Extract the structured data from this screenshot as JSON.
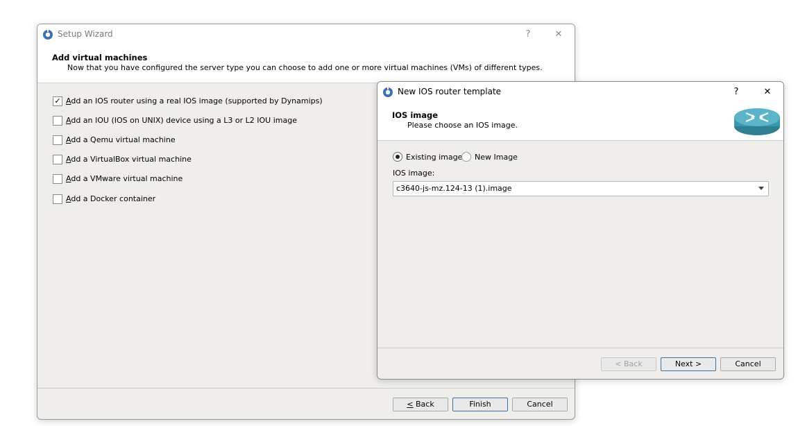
{
  "setup_wizard": {
    "title": "Setup Wizard",
    "help": "?",
    "close": "✕",
    "header_title": "Add virtual machines",
    "header_subtitle": "Now that you have configured the server type you can choose to add one or more virtual machines (VMs) of different types.",
    "options": [
      {
        "label": "Add an IOS router using a real IOS image (supported by Dynamips)",
        "checked": true
      },
      {
        "label": "Add an IOU (IOS on UNIX) device using a L3 or L2 IOU image",
        "checked": false
      },
      {
        "label": "Add a Qemu virtual machine",
        "checked": false
      },
      {
        "label": "Add a VirtualBox virtual machine",
        "checked": false
      },
      {
        "label": "Add a VMware virtual machine",
        "checked": false
      },
      {
        "label": "Add a Docker container",
        "checked": false
      }
    ],
    "back_label": "< Back",
    "finish_label": "Finish",
    "cancel_label": "Cancel"
  },
  "ios_dialog": {
    "title": "New IOS router template",
    "help": "?",
    "close": "✕",
    "header_title": "IOS image",
    "header_subtitle": "Please choose an IOS image.",
    "radio_existing": "Existing image",
    "radio_new": "New Image",
    "selected_radio": "existing",
    "ios_image_label": "IOS image:",
    "ios_image_value": "c3640-js-mz.124-13 (1).image",
    "back_label": "< Back",
    "next_label": "Next >",
    "cancel_label": "Cancel"
  },
  "colors": {
    "dialog_bg": "#f0eeeb",
    "router_icon": "#3a8fa5",
    "default_button_border": "#3a6ea5"
  }
}
